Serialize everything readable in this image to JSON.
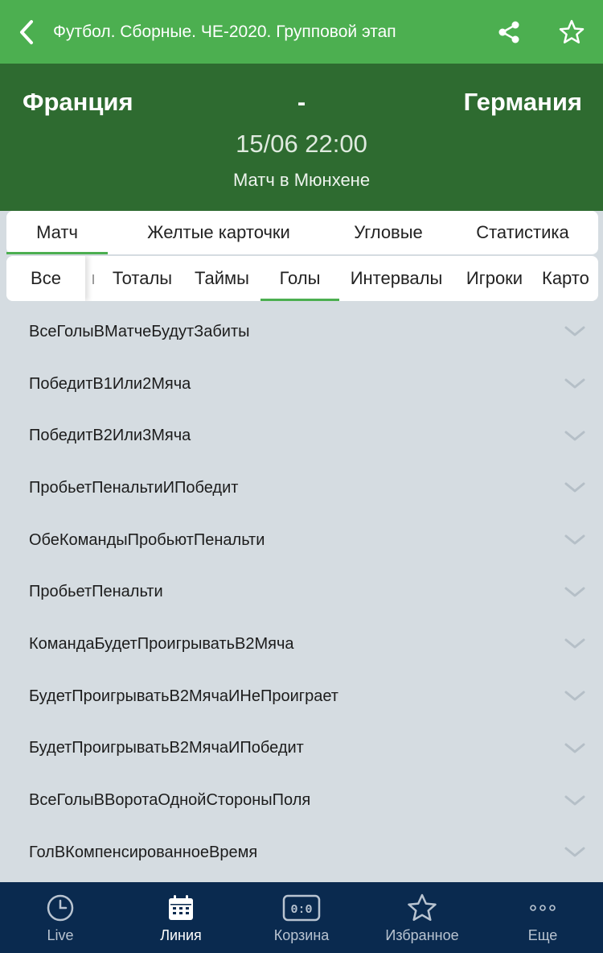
{
  "header": {
    "title": "Футбол. Сборные. ЧЕ-2020. Групповой этап"
  },
  "match": {
    "home_team": "Франция",
    "separator": "-",
    "away_team": "Германия",
    "datetime": "15/06 22:00",
    "venue": "Матч в Мюнхене"
  },
  "main_tabs": [
    {
      "label": "Матч",
      "active": true
    },
    {
      "label": "Желтые карточки",
      "active": false
    },
    {
      "label": "Угловые",
      "active": false
    },
    {
      "label": "Статистика",
      "active": false
    }
  ],
  "sub_tabs": [
    {
      "label": "Все",
      "active": false
    },
    {
      "label": "Тоталы",
      "active": false
    },
    {
      "label": "Таймы",
      "active": false
    },
    {
      "label": "Голы",
      "active": true
    },
    {
      "label": "Интервалы",
      "active": false
    },
    {
      "label": "Игроки",
      "active": false
    },
    {
      "label": "Карто",
      "active": false
    }
  ],
  "markets": [
    "ВсеГолыВМатчеБудутЗабиты",
    "ПобедитВ1Или2Мяча",
    "ПобедитВ2Или3Мяча",
    "ПробьетПенальтиИПобедит",
    "ОбеКомандыПробьютПенальти",
    "ПробьетПенальти",
    "КомандаБудетПроигрыватьВ2Мяча",
    "БудетПроигрыватьВ2МячаИНеПроиграет",
    "БудетПроигрыватьВ2МячаИПобедит",
    "ВсеГолыВВоротаОднойСтороныПоля",
    "ГолВКомпенсированноеВремя"
  ],
  "bottom_nav": [
    {
      "label": "Live",
      "icon": "clock-icon",
      "active": false
    },
    {
      "label": "Линия",
      "icon": "calendar-icon",
      "active": true
    },
    {
      "label": "Корзина",
      "icon": "scoreboard-icon",
      "score": "0:0",
      "active": false
    },
    {
      "label": "Избранное",
      "icon": "star-icon",
      "active": false
    },
    {
      "label": "Еще",
      "icon": "more-icon",
      "active": false
    }
  ],
  "colors": {
    "topbar": "#4caf50",
    "match_header": "#2e6b30",
    "accent": "#4caf50",
    "list_background": "#d5dce1",
    "bottom_nav": "#0a2a4f"
  }
}
